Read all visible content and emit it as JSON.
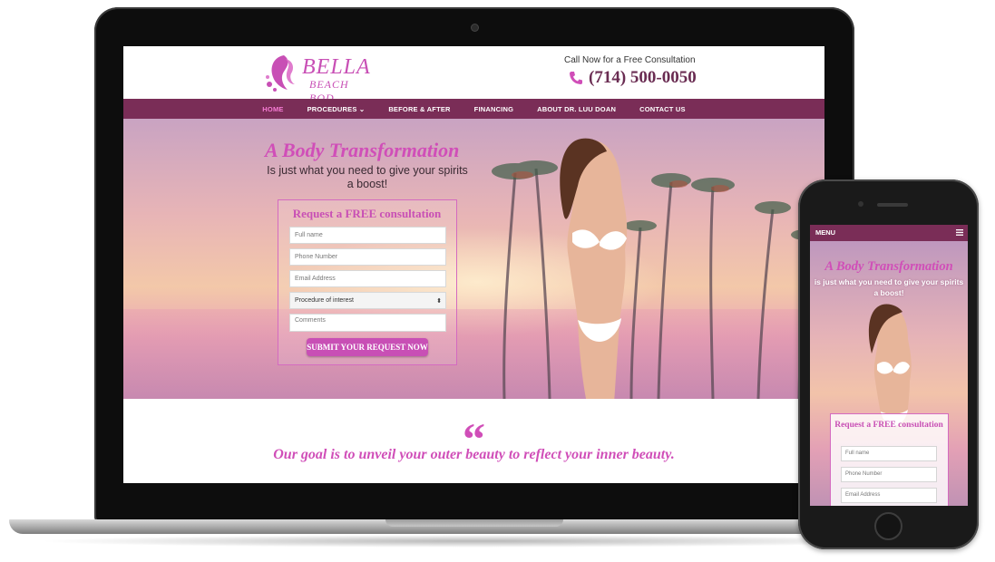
{
  "brand": {
    "name_line1": "BELLA",
    "name_line2": "BEACH BOD"
  },
  "header": {
    "call_text": "Call Now for a Free Consultation",
    "phone": "(714) 500-0050"
  },
  "nav": {
    "items": [
      {
        "label": "HOME",
        "active": true
      },
      {
        "label": "PROCEDURES ⌄",
        "active": false
      },
      {
        "label": "BEFORE & AFTER",
        "active": false
      },
      {
        "label": "FINANCING",
        "active": false
      },
      {
        "label": "ABOUT DR. LUU DOAN",
        "active": false
      },
      {
        "label": "CONTACT US",
        "active": false
      }
    ]
  },
  "hero": {
    "title": "A Body Transformation",
    "subtitle": "Is just what you need to give your spirits a boost!"
  },
  "form": {
    "title": "Request a FREE consultation",
    "full_name_placeholder": "Full name",
    "phone_placeholder": "Phone Number",
    "email_placeholder": "Email Address",
    "procedure_selected": "Procedure of interest",
    "comments_placeholder": "Comments",
    "submit_label": "SUBMIT YOUR REQUEST NOW"
  },
  "quote": {
    "mark": "“",
    "text": "Our goal is to unveil your outer beauty to reflect your inner beauty."
  },
  "mobile": {
    "menu_label": "MENU",
    "title": "A Body Transformation",
    "subtitle": "is just what you need to give your spirits a boost!",
    "form_title": "Request a FREE consultation",
    "full_name_placeholder": "Full name",
    "phone_placeholder": "Phone Number",
    "email_placeholder": "Email Address"
  },
  "colors": {
    "accent_pink": "#d04eb8",
    "nav_plum": "#7a2d57",
    "phone_plum": "#6a2c52"
  },
  "icons": [
    "logo-face-icon",
    "phone-icon",
    "chevron-down-icon",
    "hamburger-icon",
    "quote-icon"
  ]
}
